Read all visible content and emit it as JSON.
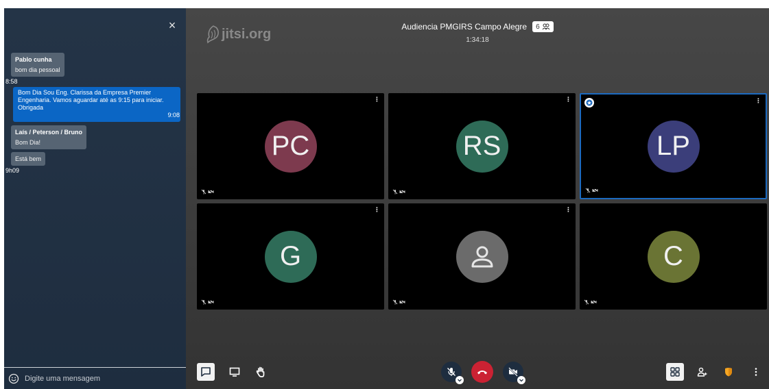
{
  "chat": {
    "close_label": "×",
    "messages": [
      {
        "author": "Pablo cunha",
        "texts": [
          "bom dia pessoal"
        ],
        "time": "8:58"
      },
      {
        "local_text": "Bom Dia Sou Eng. Clarissa da Empresa Premier Engenharia. Vamos aguardar até as 9:15 para iniciar. Obrigada",
        "time": "9:08"
      },
      {
        "author": "Laís / Peterson / Bruno",
        "texts": [
          "Bom Dia!",
          "Está bem"
        ],
        "time": "9h09"
      }
    ],
    "input_placeholder": "Digite uma mensagem",
    "emoji_icon": "smile-icon"
  },
  "watermark": {
    "text": "jitsi.org"
  },
  "conference": {
    "subject": "Audiencia PMGIRS Campo Alegre",
    "participant_count": "6",
    "timer": "1:34:18"
  },
  "tiles": [
    {
      "initials": "PC",
      "color": "#7d3a4e",
      "moderator": false,
      "active": false,
      "menu": "⋮"
    },
    {
      "initials": "RS",
      "color": "#2e6b57",
      "moderator": false,
      "active": false,
      "menu": "⋮"
    },
    {
      "initials": "LP",
      "color": "#3b3e7a",
      "moderator": true,
      "active": true,
      "menu": "⋮"
    },
    {
      "initials": "G",
      "color": "#2e6b57",
      "moderator": false,
      "active": false,
      "menu": "⋮"
    },
    {
      "initials": "",
      "color": "#6b6b6b",
      "moderator": false,
      "active": false,
      "menu": "⋮",
      "default_avatar": true
    },
    {
      "initials": "C",
      "color": "#6a7434",
      "moderator": false,
      "active": false,
      "menu": ""
    }
  ],
  "toolbar": {
    "left": [
      "chat-icon",
      "screenshare-icon",
      "raise-hand-icon"
    ],
    "center": [
      "mic-muted-icon",
      "hangup-icon",
      "camera-off-icon"
    ],
    "right": [
      "tile-view-icon",
      "invite-icon",
      "security-icon",
      "more-icon"
    ],
    "colors": {
      "hangup": "#cb2233",
      "security": "#f5a623",
      "accent": "#0b66c5"
    }
  }
}
